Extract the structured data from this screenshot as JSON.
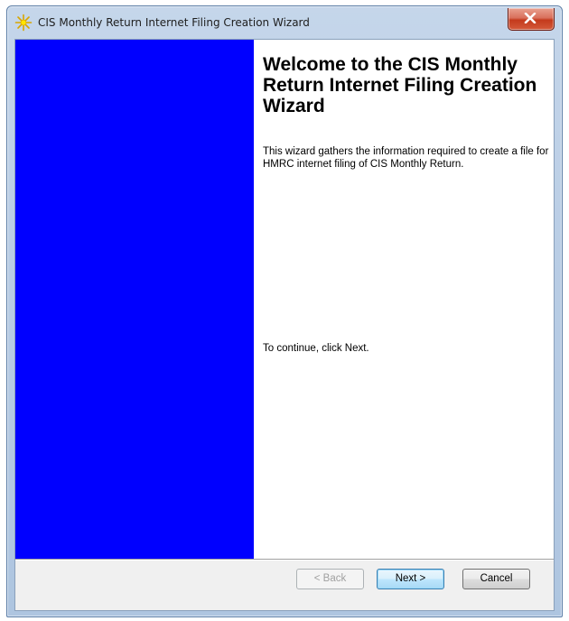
{
  "window": {
    "title": "CIS Monthly Return Internet Filing Creation Wizard",
    "icon": "wizard-sparkle-icon",
    "close_icon": "close-icon"
  },
  "banner": {
    "color": "#0000ff"
  },
  "content": {
    "heading": "Welcome to the CIS Monthly Return Internet Filing Creation Wizard",
    "intro": "This wizard gathers the information required to create a file for HMRC internet filing of CIS Monthly Return.",
    "continue_text": "To continue, click Next."
  },
  "buttons": {
    "back": "< Back",
    "next": "Next >",
    "cancel": "Cancel"
  },
  "colors": {
    "close_button": "#c43a1c",
    "default_button_border": "#3c7fb1"
  }
}
